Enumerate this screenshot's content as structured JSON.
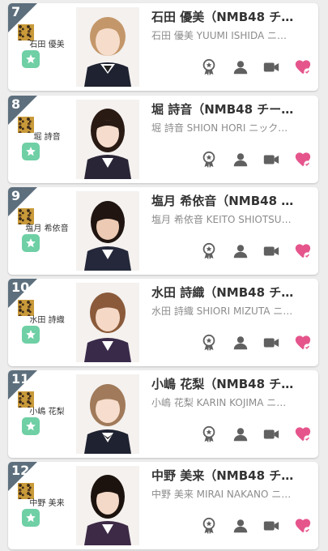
{
  "colors": {
    "rank_bg": "#5d6f7d",
    "badge": "#6fcfa5",
    "icon": "#606060",
    "heart": "#e5558c",
    "card": "#ffffff",
    "background": "#ededed"
  },
  "members": [
    {
      "rank": "7",
      "name": "石田 優美",
      "title": "石田 優美（NMB48 チ…",
      "subtitle": "石田 優美 YUUMI ISHIDA ニ…"
    },
    {
      "rank": "8",
      "name": "堀 詩音",
      "title": "堀 詩音（NMB48 チー…",
      "subtitle": "堀 詩音 SHION HORI ニック…"
    },
    {
      "rank": "9",
      "name": "塩月 希依音",
      "title": "塩月 希依音（NMB48 …",
      "subtitle": "塩月 希依音 KEITO SHIOTSU…"
    },
    {
      "rank": "10",
      "name": "水田 詩織",
      "title": "水田 詩織（NMB48 チ…",
      "subtitle": "水田 詩織 SHIORI MIZUTA ニ…"
    },
    {
      "rank": "11",
      "name": "小嶋 花梨",
      "title": "小嶋 花梨（NMB48 チ…",
      "subtitle": "小嶋 花梨 KARIN KOJIMA ニ…"
    },
    {
      "rank": "12",
      "name": "中野 美来",
      "title": "中野 美来（NMB48 チ…",
      "subtitle": "中野 美来 MIRAI NAKANO ニ…"
    }
  ]
}
